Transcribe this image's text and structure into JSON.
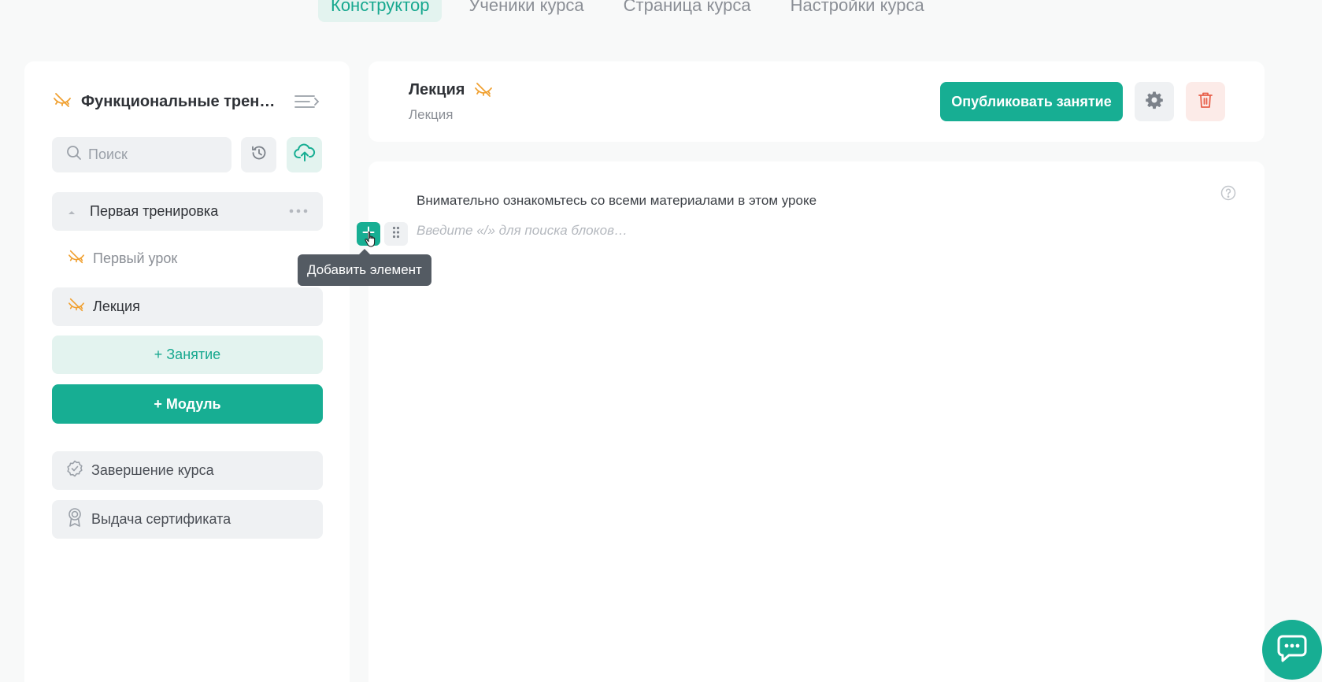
{
  "tabs": [
    {
      "label": "Конструктор",
      "active": true
    },
    {
      "label": "Ученики курса"
    },
    {
      "label": "Страница курса"
    },
    {
      "label": "Настройки курса"
    }
  ],
  "sidebar": {
    "course_title": "Функциональные трени…",
    "search_placeholder": "Поиск",
    "module": {
      "label": "Первая тренировка"
    },
    "lessons": [
      {
        "label": "Первый урок"
      },
      {
        "label": "Лекция"
      }
    ],
    "add_lesson_label": "+ Занятие",
    "add_module_label": "+ Модуль",
    "finish_label": "Завершение курса",
    "certificate_label": "Выдача сертификата"
  },
  "lesson": {
    "title": "Лекция",
    "subtitle": "Лекция",
    "publish_label": "Опубликовать занятие"
  },
  "editor": {
    "text": "Внимательно ознакомьтесь со всеми материалами в этом уроке",
    "placeholder": "Введите «/» для поиска блоков…",
    "tooltip": "Добавить элемент"
  },
  "colors": {
    "accent": "#17ae93",
    "hidden_icon": "#f0a030",
    "danger": "#e8604a"
  }
}
